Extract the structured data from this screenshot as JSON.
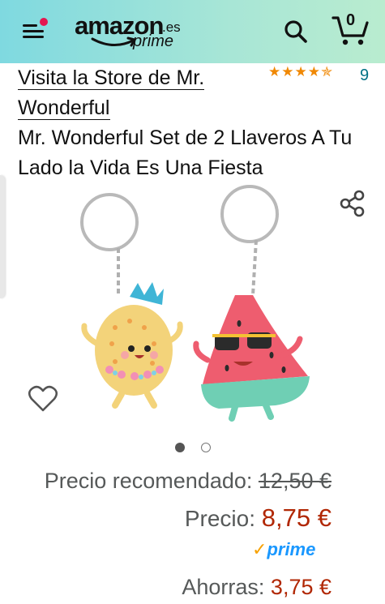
{
  "header": {
    "logo_word": "amazon",
    "logo_tld": ".es",
    "logo_prime": "prime",
    "cart_count": "0",
    "icons": [
      "menu-icon",
      "search-icon",
      "cart-icon"
    ]
  },
  "product": {
    "store_link": "Visita la Store de Mr. Wonderful",
    "rating_stars": "★★★★✯",
    "rating_value": 4.5,
    "rating_count": "9",
    "title": "Mr. Wonderful Set de 2 Llaveros A Tu Lado la Vida Es Una Fiesta",
    "image_indicator": {
      "total": 2,
      "active": 1
    }
  },
  "pricing": {
    "recommended_label": "Precio recomendado:",
    "recommended_value": "12,50 €",
    "price_label": "Precio:",
    "price_value": "8,75 €",
    "prime_check": "✓",
    "prime_label": "prime",
    "savings_label": "Ahorras:",
    "savings_value": "3,75 €"
  },
  "colors": {
    "header_gradient_start": "#7fd9e0",
    "header_gradient_end": "#b9eccf",
    "price_red": "#b12704",
    "link_teal": "#007185",
    "star_orange": "#f08804",
    "prime_blue": "#1a98ff"
  }
}
